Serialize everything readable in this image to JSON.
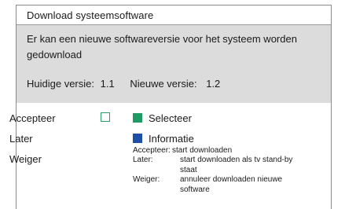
{
  "dialog": {
    "title": "Download systeemsoftware",
    "message": "Er kan een nieuwe softwareversie voor het systeem worden gedownload",
    "current_version_label": "Huidige versie:",
    "current_version_value": "1.1",
    "new_version_label": "Nieuwe versie:",
    "new_version_value": "1.2"
  },
  "menu": {
    "items": [
      {
        "label": "Accepteer"
      },
      {
        "label": "Later"
      },
      {
        "label": "Weiger"
      }
    ]
  },
  "legend": {
    "items": [
      {
        "label": "Selecteer",
        "color": "#1f9a62"
      },
      {
        "label": "Informatie",
        "color": "#1d4fa8"
      }
    ]
  },
  "help": {
    "rows": [
      {
        "key": "Accepteer:",
        "text": "start downloaden"
      },
      {
        "key": "Later:",
        "text": "start downloaden als tv stand-by staat"
      },
      {
        "key": "Weiger:",
        "text": "annuleer downloaden nieuwe software"
      }
    ]
  },
  "colors": {
    "panel_bg": "#dcdcdc",
    "checkbox_border": "#2e9a6a"
  }
}
